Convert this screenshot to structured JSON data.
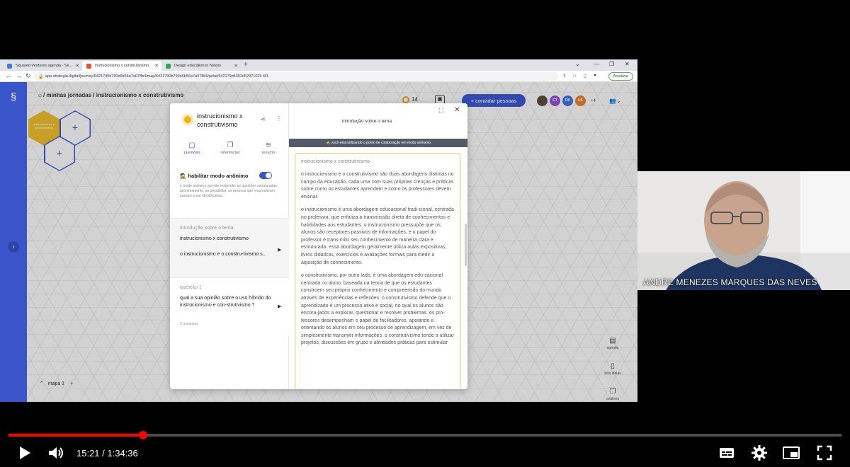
{
  "browser": {
    "tabs": [
      {
        "label": "Squared Ventures agenda - Se...",
        "color": "#3b7ddd",
        "active": false
      },
      {
        "label": "instrucionismo x construtivismo",
        "color": "#e4572e",
        "active": true
      },
      {
        "label": "Design education in history",
        "color": "#2aa55a",
        "active": false
      }
    ],
    "url": "app.strategia.digital/journey/6421790b790e6b56a7a078b4/map/6421790b790e6b56a7a078b5/point/642179d4352d52971026 6f1",
    "update_label": "Atualizar"
  },
  "app": {
    "breadcrumb": "⌂  /  minhas jornadas  /  instrucionismo x construtivismo",
    "coins": "14",
    "invite_label": "+ convidar pessoas",
    "avatars": [
      {
        "initials": "",
        "color": "#5b4a3a"
      },
      {
        "initials": "CT",
        "color": "#8a4fcf"
      },
      {
        "initials": "DK",
        "color": "#3a6fd6"
      },
      {
        "initials": "LS",
        "color": "#e07a2a"
      }
    ],
    "avatar_more": "+4",
    "hex_label": "instrucionismo x construtivismo",
    "map_tab": "mapa 1",
    "right_tools": [
      {
        "icon": "▤",
        "label": "agenda"
      },
      {
        "icon": "▯",
        "label": "lista ideias"
      },
      {
        "icon": "❒",
        "label": "análises"
      }
    ]
  },
  "modal": {
    "title": "instrucionismo x construtivismo",
    "tabs": [
      {
        "icon": "▢",
        "label": "questões"
      },
      {
        "icon": "❐",
        "label": "referências"
      },
      {
        "icon": "≋",
        "label": "resumo"
      }
    ],
    "anon_label": "habilitar modo anônimo",
    "anon_desc": "o modo anônimo permite responder as questões estruturadas anonimamente. ao desabilitar, as pessoas que responderam passam a ser identificadas.",
    "intro_card": {
      "label": "introdução sobre o tema",
      "title": "instrucionismo x construtivismo",
      "preview": "o instrucionismo e o constru-tivismo s..."
    },
    "question_card": {
      "label": "questão 1",
      "text": "qual a sua opinião sobre o uso híbrido do instrucionismo e con-strutivismo ?",
      "responses": "0 respostas"
    },
    "right_title": "introdução sobre o tema",
    "banner": "você está utilizando o ponto de colaboração em modo anônimo",
    "doc_heading": "instrucionismo x construtivismo",
    "doc_paragraphs": [
      "o instrucionismo e o construtivismo são duas abordagens distintas no campo da educação, cada uma com suas próprias crenças e práticas sobre como os estudantes aprendem e como os professores devem ensinar.",
      "o instrucionismo é uma abordagem educacional tradi-cional, centrada no professor, que enfatiza a transmissão direta de conhecimentos e habilidades aos estudantes. o instrucionismo pressupõe que os alunos são receptores passivos de informações, e o papel do professor é trans-mitir seu conhecimento de maneira clara e estruturada. essa abordagem geralmente utiliza aulas expositivas, livros didáticos, exercícios e avaliações formais para medir a aquisição de conhecimento.",
      "o construtivismo, por outro lado, é uma abordagem edu-cacional centrada no aluno, baseada na teoria de que os estudantes constroem seu próprio conhecimento e compreensão do mundo através de experiências e reflexões. o construtivismo defende que o aprendizado é um processo ativo e social, no qual os alunos são encora-jados a explorar, questionar e resolver problemas. os pro-fessores desempenham o papel de facilitadores, apoiando e orientando os alunos em seu processo de aprendizagem, em vez de simplesmente transmitir informações. o construtivismo tende a utilizar projetos, discussões em grupo e atividades práticas para estimular"
    ]
  },
  "webcam": {
    "participant_name": "ANDRE MENEZES MARQUES DAS NEVES"
  },
  "player": {
    "current_time": "15:21",
    "duration": "1:34:36",
    "time_display": "15:21 / 1:34:36",
    "progress": 0.1619
  }
}
